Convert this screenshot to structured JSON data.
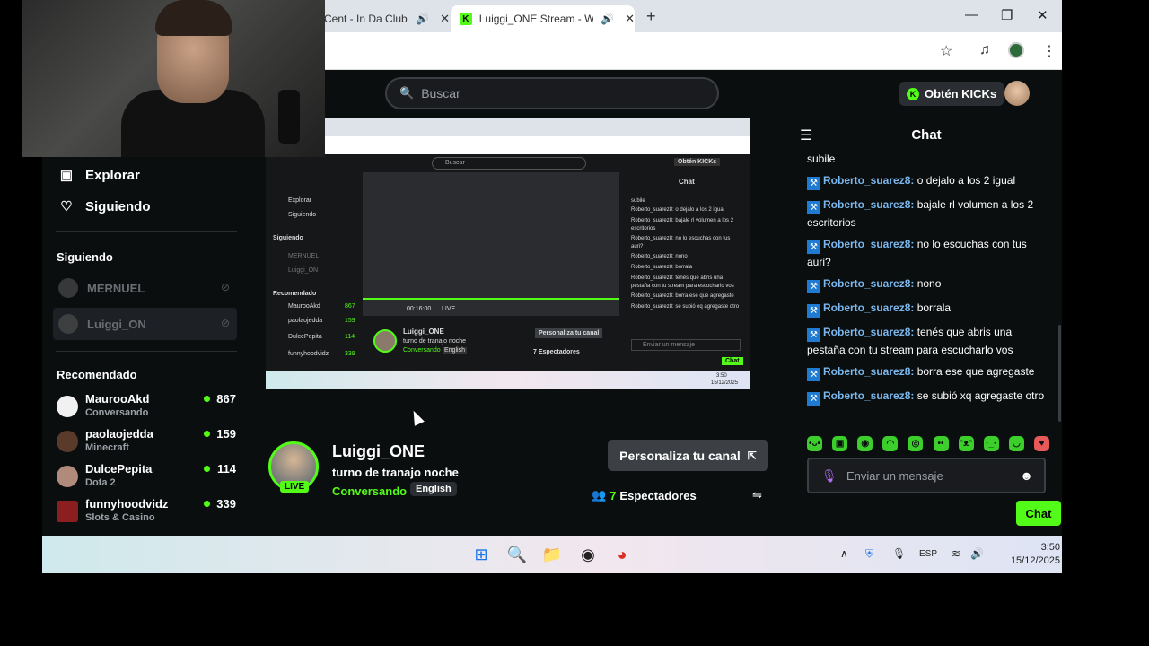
{
  "browser": {
    "tabs": [
      {
        "title": "Cent - In Da Club (",
        "audio_icon": "speaker-icon"
      },
      {
        "title": "Luiggi_ONE Stream - Watch",
        "audio_icon": "speaker-icon",
        "favicon": "K"
      }
    ],
    "new_tab": "+",
    "window_controls": [
      "—",
      "❐",
      "✕"
    ]
  },
  "header": {
    "search_placeholder": "Buscar",
    "kicks_label": "Obtén KICKs",
    "kick_glyph": "K"
  },
  "sidebar": {
    "nav": [
      {
        "label": "Explorar",
        "icon": "explore-icon"
      },
      {
        "label": "Siguiendo",
        "icon": "heart-icon"
      }
    ],
    "following_heading": "Siguiendo",
    "following": [
      {
        "name": "MERNUEL"
      },
      {
        "name": "Luiggi_ON"
      }
    ],
    "recommended_heading": "Recomendado",
    "recommended": [
      {
        "name": "MaurooAkd",
        "category": "Conversando",
        "viewers": "867"
      },
      {
        "name": "paolaojedda",
        "category": "Minecraft",
        "viewers": "159"
      },
      {
        "name": "DulcePepita",
        "category": "Dota 2",
        "viewers": "114"
      },
      {
        "name": "funnyhoodvidz",
        "category": "Slots & Casino",
        "viewers": "339"
      }
    ]
  },
  "stream": {
    "streamer": "Luiggi_ONE",
    "title": "turno de tranajo noche",
    "category": "Conversando",
    "language": "English",
    "live_badge": "LIVE",
    "customize_label": "Personaliza tu canal",
    "viewer_count": "7",
    "viewers_label": "Espectadores"
  },
  "chat": {
    "title": "Chat",
    "messages": [
      {
        "user": "",
        "text": "subile"
      },
      {
        "user": "Roberto_suarez8:",
        "text": " o dejalo a los 2 igual"
      },
      {
        "user": "Roberto_suarez8:",
        "text": " bajale rl volumen a los 2 escritorios"
      },
      {
        "user": "Roberto_suarez8:",
        "text": " no lo escuchas con tus auri?"
      },
      {
        "user": "Roberto_suarez8:",
        "text": " nono"
      },
      {
        "user": "Roberto_suarez8:",
        "text": " borrala"
      },
      {
        "user": "Roberto_suarez8:",
        "text": " tenés que abris una pestaña con tu stream para escucharlo vos"
      },
      {
        "user": "Roberto_suarez8:",
        "text": " borra ese que agregaste"
      },
      {
        "user": "Roberto_suarez8:",
        "text": " se subió xq agregaste otro"
      }
    ],
    "input_placeholder": "Enviar un mensaje",
    "send_label": "Chat"
  },
  "inner_stream": {
    "search": "Buscar",
    "kicks": "Obtén KICKs",
    "chat_title": "Chat",
    "nav": [
      "Explorar",
      "Siguiendo"
    ],
    "following_heading": "Siguiendo",
    "following": [
      "MERNUEL",
      "Luiggi_ON"
    ],
    "recommended_heading": "Recomendado",
    "recommended": [
      "MaurooAkd",
      "paolaojedda",
      "DulcePepita",
      "funnyhoodvidz"
    ],
    "recommended_counts": [
      "867",
      "159",
      "114",
      "339"
    ],
    "time": "00:16:00",
    "live": "LIVE",
    "streamer": "Luiggi_ONE",
    "title": "turno de tranajo noche",
    "category": "Conversando",
    "language": "English",
    "customize": "Personaliza tu canal",
    "viewers": "7 Espectadores",
    "chat_lines": [
      "subile",
      "Roberto_suarez8: o dejalo a los 2 igual",
      "Roberto_suarez8: bajale rl volumen a los 2 escritorios",
      "Roberto_suarez8: no lo escuchas con tus auri?",
      "Roberto_suarez8: nono",
      "Roberto_suarez8: borrala",
      "Roberto_suarez8: tenés que abris una pestaña con tu stream para escucharlo vos",
      "Roberto_suarez8: borra ese que agregaste",
      "Roberto_suarez8: se subió xq agregaste otro"
    ],
    "input": "Enviar un mensaje",
    "send": "Chat",
    "clock": "3:50",
    "date": "15/12/2025"
  },
  "taskbar": {
    "language": "ESP",
    "time": "3:50",
    "date": "15/12/2025"
  },
  "colors": {
    "accent": "#53fc18",
    "background": "#0b0e0f",
    "chat_username": "#7ab8ef"
  }
}
